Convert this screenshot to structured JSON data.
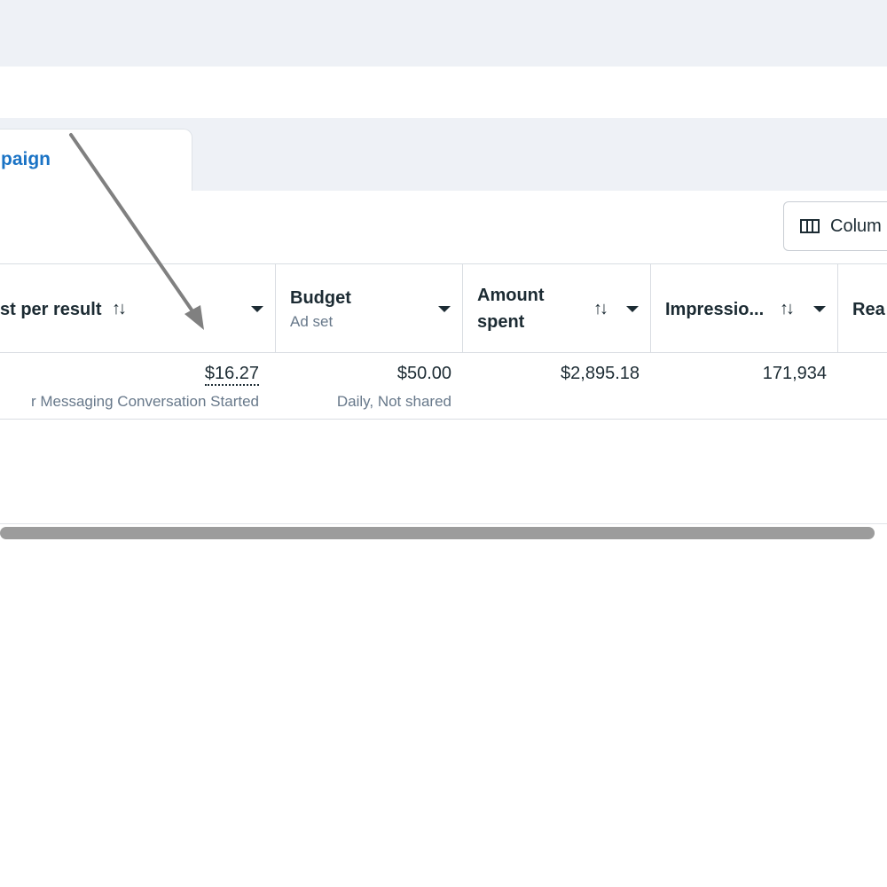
{
  "tab": {
    "active_label": "paign"
  },
  "toolbar": {
    "columns_label": "Colum",
    "columns_icon": "columns-icon"
  },
  "table": {
    "headers": [
      {
        "label": "st per result",
        "sub": "",
        "sortable": true,
        "dropdown": true
      },
      {
        "label": "Budget",
        "sub": "Ad set",
        "sortable": false,
        "dropdown": true
      },
      {
        "label": "Amount spent",
        "line1": "Amount",
        "line2": "spent",
        "sortable": true,
        "dropdown": true
      },
      {
        "label": "Impressio...",
        "sortable": true,
        "dropdown": true
      },
      {
        "label": "Rea",
        "sortable": false,
        "dropdown": false
      }
    ],
    "sort_glyph": "↑↓",
    "row": {
      "cost_per_result": "$16.27",
      "cost_per_result_sub": "r Messaging Conversation Started",
      "budget": "$50.00",
      "budget_sub": "Daily, Not shared",
      "amount_spent": "$2,895.18",
      "impressions": "171,934"
    }
  },
  "colors": {
    "accent": "#1a73c5",
    "header_bg": "#eef1f6",
    "border": "#d9dde2",
    "arrow": "#808080"
  }
}
